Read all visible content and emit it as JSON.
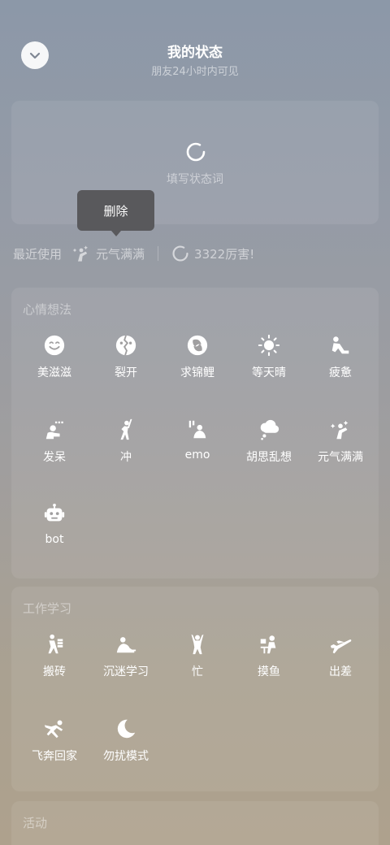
{
  "header": {
    "title": "我的状态",
    "subtitle": "朋友24小时内可见"
  },
  "status_input": {
    "placeholder": "填写状态词"
  },
  "tooltip": {
    "label": "删除"
  },
  "recent": {
    "label": "最近使用",
    "items": [
      {
        "label": "元气满满",
        "icon": "energetic-icon"
      },
      {
        "label": "3322厉害!",
        "icon": "loading-ring-icon"
      }
    ]
  },
  "sections": [
    {
      "title": "心情想法",
      "items": [
        {
          "label": "美滋滋",
          "icon": "smile-icon"
        },
        {
          "label": "裂开",
          "icon": "cracked-face-icon"
        },
        {
          "label": "求锦鲤",
          "icon": "koi-icon"
        },
        {
          "label": "等天晴",
          "icon": "sun-icon"
        },
        {
          "label": "疲惫",
          "icon": "tired-icon"
        },
        {
          "label": "发呆",
          "icon": "daze-icon"
        },
        {
          "label": "冲",
          "icon": "charge-icon"
        },
        {
          "label": "emo",
          "icon": "emo-icon"
        },
        {
          "label": "胡思乱想",
          "icon": "thought-cloud-icon"
        },
        {
          "label": "元气满满",
          "icon": "energetic-icon"
        },
        {
          "label": "bot",
          "icon": "robot-icon"
        }
      ]
    },
    {
      "title": "工作学习",
      "items": [
        {
          "label": "搬砖",
          "icon": "moving-bricks-icon"
        },
        {
          "label": "沉迷学习",
          "icon": "studying-icon"
        },
        {
          "label": "忙",
          "icon": "busy-icon"
        },
        {
          "label": "摸鱼",
          "icon": "slacking-icon"
        },
        {
          "label": "出差",
          "icon": "airplane-icon"
        },
        {
          "label": "飞奔回家",
          "icon": "running-home-icon"
        },
        {
          "label": "勿扰模式",
          "icon": "moon-icon"
        }
      ]
    },
    {
      "title": "活动",
      "items": []
    }
  ]
}
